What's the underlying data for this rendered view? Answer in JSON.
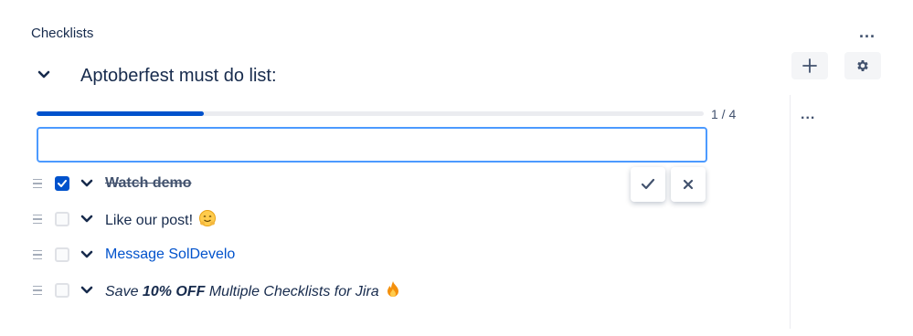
{
  "panel": {
    "title": "Checklists",
    "more_label": "..."
  },
  "toolbar": {
    "add_icon": "plus-icon",
    "settings_icon": "gear-icon"
  },
  "checklist": {
    "title": "Aptoberfest must do list:",
    "progress": {
      "done": 1,
      "total": 4,
      "label": "1 / 4",
      "fraction": 0.25,
      "color": "#0052cc"
    },
    "side_more_label": "...",
    "new_item": {
      "value": "",
      "placeholder": ""
    },
    "items": [
      {
        "label": "Watch demo",
        "checked": true,
        "style": "done"
      },
      {
        "label": "Like our post!",
        "checked": false,
        "emoji": "hugging-face-emoji"
      },
      {
        "label": "Message SolDevelo",
        "checked": false,
        "style": "link"
      },
      {
        "prefix": "Save ",
        "bold": "10% OFF",
        "suffix": " Multiple Checklists for Jira",
        "checked": false,
        "emoji": "fire-emoji"
      }
    ]
  },
  "colors": {
    "accent": "#0052cc",
    "text": "#172b4d",
    "focus": "#4c9aff"
  }
}
